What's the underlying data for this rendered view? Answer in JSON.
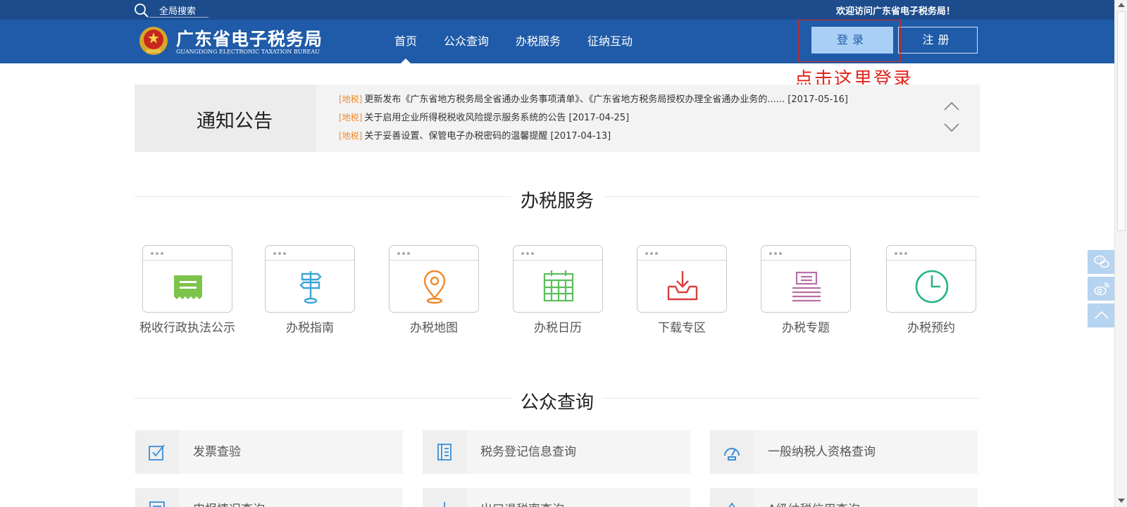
{
  "topbar": {
    "search_label": "全局搜索",
    "welcome": "欢迎访问广东省电子税务局！"
  },
  "header": {
    "logo_cn": "广东省电子税务局",
    "logo_en": "GUANGDONG ELECTRONIC TAXATION BUREAU",
    "nav": [
      {
        "label": "首页",
        "active": true
      },
      {
        "label": "公众查询",
        "active": false
      },
      {
        "label": "办税服务",
        "active": false
      },
      {
        "label": "征纳互动",
        "active": false
      }
    ],
    "login_label": "登录",
    "register_label": "注册",
    "annotation": "点击这里登录"
  },
  "notice": {
    "title": "通知公告",
    "items": [
      {
        "tag": "[地税]",
        "text": "更新发布《广东省地方税务局全省通办业务事项清单》、《广东省地方税务局授权办理全省通办业务的...... [2017-05-16]"
      },
      {
        "tag": "[地税]",
        "text": "关于启用企业所得税税收风险提示服务系统的公告 [2017-04-25]"
      },
      {
        "tag": "[地税]",
        "text": "关于妥善设置、保管电子办税密码的温馨提醒 [2017-04-13]"
      }
    ]
  },
  "services": {
    "title": "办税服务",
    "items": [
      {
        "label": "税收行政执法公示",
        "icon": "ticket-icon",
        "color": "#7cc44a"
      },
      {
        "label": "办税指南",
        "icon": "signpost-icon",
        "color": "#3aa6d8"
      },
      {
        "label": "办税地图",
        "icon": "map-pin-icon",
        "color": "#f08a2c"
      },
      {
        "label": "办税日历",
        "icon": "calendar-icon",
        "color": "#5cbf5c"
      },
      {
        "label": "下载专区",
        "icon": "download-tray-icon",
        "color": "#d9403c"
      },
      {
        "label": "办税专题",
        "icon": "document-stack-icon",
        "color": "#b86fa8"
      },
      {
        "label": "办税预约",
        "icon": "clock-icon",
        "color": "#27b38a"
      }
    ]
  },
  "queries": {
    "title": "公众查询",
    "items": [
      {
        "label": "发票查验",
        "icon": "checkbox-icon"
      },
      {
        "label": "税务登记信息查询",
        "icon": "ledger-icon"
      },
      {
        "label": "一般纳税人资格查询",
        "icon": "gauge-icon"
      },
      {
        "label": "申报情况查询",
        "icon": "form-icon"
      },
      {
        "label": "出口退税率查询",
        "icon": "chart-icon"
      },
      {
        "label": "A级纳税信用查询",
        "icon": "badge-icon"
      }
    ]
  },
  "side": [
    "wechat-icon",
    "weibo-icon",
    "back-to-top-icon"
  ],
  "colors": {
    "topbar": "#1d4c8c",
    "header": "#1f5ba8",
    "login_button": "#aacff6",
    "annotation": "#e0241b",
    "notice_tag": "#f08a2c"
  }
}
